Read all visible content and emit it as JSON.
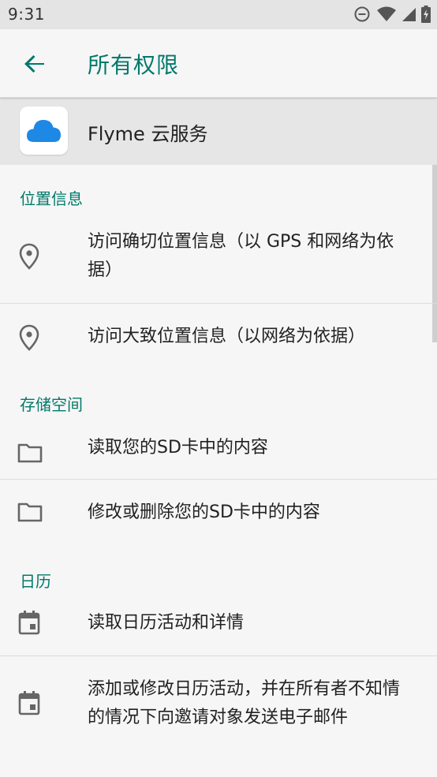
{
  "status_bar": {
    "time": "9:31"
  },
  "app_bar": {
    "title": "所有权限"
  },
  "app_header": {
    "app_name": "Flyme 云服务"
  },
  "sections": [
    {
      "title": "位置信息",
      "items": [
        {
          "label": "访问确切位置信息（以 GPS 和网络为依据）",
          "icon": "location-icon"
        },
        {
          "label": "访问大致位置信息（以网络为依据）",
          "icon": "location-icon"
        }
      ]
    },
    {
      "title": "存储空间",
      "items": [
        {
          "label": "读取您的SD卡中的内容",
          "icon": "folder-icon"
        },
        {
          "label": "修改或删除您的SD卡中的内容",
          "icon": "folder-icon"
        }
      ]
    },
    {
      "title": "日历",
      "items": [
        {
          "label": "读取日历活动和详情",
          "icon": "calendar-icon"
        },
        {
          "label": "添加或修改日历活动，并在所有者不知情的情况下向邀请对象发送电子邮件",
          "icon": "calendar-icon"
        }
      ]
    }
  ],
  "colors": {
    "accent": "#00796b",
    "app_icon_blue": "#1e88e5"
  }
}
